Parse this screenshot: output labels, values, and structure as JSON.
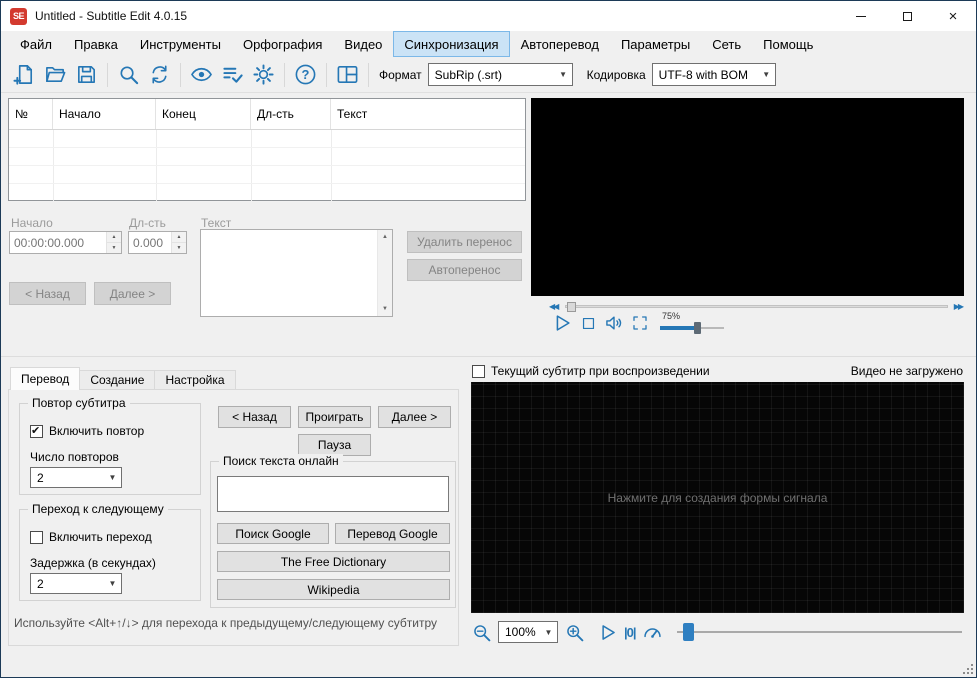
{
  "window": {
    "title": "Untitled - Subtitle Edit 4.0.15",
    "logo_text": "SE"
  },
  "menu": {
    "items": [
      {
        "label": "Файл"
      },
      {
        "label": "Правка"
      },
      {
        "label": "Инструменты"
      },
      {
        "label": "Орфография"
      },
      {
        "label": "Видео"
      },
      {
        "label": "Синхронизация"
      },
      {
        "label": "Автоперевод"
      },
      {
        "label": "Параметры"
      },
      {
        "label": "Сеть"
      },
      {
        "label": "Помощь"
      }
    ]
  },
  "toolbar": {
    "format_label": "Формат",
    "format_value": "SubRip (.srt)",
    "encoding_label": "Кодировка",
    "encoding_value": "UTF-8 with BOM"
  },
  "subtitle_list": {
    "columns": [
      "№",
      "Начало",
      "Конец",
      "Дл-сть",
      "Текст"
    ]
  },
  "edit_panel": {
    "start_label": "Начало",
    "start_value": "00:00:00.000",
    "duration_label": "Дл-сть",
    "duration_value": "0.000",
    "text_label": "Текст",
    "back_button": "< Назад",
    "next_button": "Далее >",
    "remove_break_button": "Удалить перенос",
    "auto_break_button": "Автоперенос"
  },
  "video_player": {
    "volume_value": "75%",
    "status": "Видео не загружено"
  },
  "translate_tab": {
    "tabs": [
      {
        "label": "Перевод"
      },
      {
        "label": "Создание"
      },
      {
        "label": "Настройка"
      }
    ],
    "repeat_group": {
      "title": "Повтор субтитра",
      "enable_label": "Включить повтор",
      "count_label": "Число повторов",
      "count_value": "2"
    },
    "goto_next_group": {
      "title": "Переход к следующему",
      "enable_label": "Включить переход",
      "delay_label": "Задержка (в секундах)",
      "delay_value": "2"
    },
    "back_button": "< Назад",
    "play_button": "Проиграть",
    "next_button": "Далее >",
    "pause_button": "Пауза",
    "online_search_group": {
      "title": "Поиск текста онлайн",
      "query_value": "",
      "google_search_button": "Поиск Google",
      "google_translate_button": "Перевод Google",
      "free_dictionary_button": "The Free Dictionary",
      "wikipedia_button": "Wikipedia"
    },
    "hint": "Используйте <Alt+↑/↓> для перехода к предыдущему/следующему субтитру"
  },
  "waveform": {
    "show_current_checkbox": "Текущий субтитр при воспроизведении",
    "click_hint": "Нажмите для создания формы сигнала",
    "zoom_value": "100%",
    "position_marker": "|0|"
  }
}
